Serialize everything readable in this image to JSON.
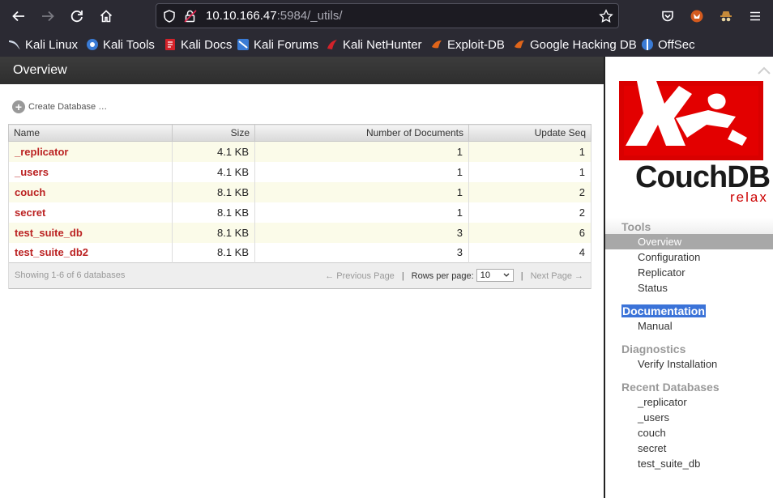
{
  "browser": {
    "url_host": "10.10.166.47",
    "url_rest": ":5984/_utils/",
    "bookmarks": [
      {
        "label": "Kali Linux",
        "color": "#5a9de0"
      },
      {
        "label": "Kali Tools",
        "color": "#3a7bd5"
      },
      {
        "label": "Kali Docs",
        "color": "#d3222a"
      },
      {
        "label": "Kali Forums",
        "color": "#3a7bd5"
      },
      {
        "label": "Kali NetHunter",
        "color": "#d3222a"
      },
      {
        "label": "Exploit-DB",
        "color": "#e0651a"
      },
      {
        "label": "Google Hacking DB",
        "color": "#e0651a"
      },
      {
        "label": "OffSec",
        "color": "#3a7bd5"
      }
    ]
  },
  "page": {
    "title": "Overview",
    "create_db": "Create Database …"
  },
  "table": {
    "headers": [
      "Name",
      "Size",
      "Number of Documents",
      "Update Seq"
    ],
    "rows": [
      {
        "name": "_replicator",
        "size": "4.1 KB",
        "docs": "1",
        "seq": "1"
      },
      {
        "name": "_users",
        "size": "4.1 KB",
        "docs": "1",
        "seq": "1"
      },
      {
        "name": "couch",
        "size": "8.1 KB",
        "docs": "1",
        "seq": "2"
      },
      {
        "name": "secret",
        "size": "8.1 KB",
        "docs": "1",
        "seq": "2"
      },
      {
        "name": "test_suite_db",
        "size": "8.1 KB",
        "docs": "3",
        "seq": "6"
      },
      {
        "name": "test_suite_db2",
        "size": "8.1 KB",
        "docs": "3",
        "seq": "4"
      }
    ],
    "footer": {
      "showing": "Showing 1-6 of 6 databases",
      "prev": "← Previous Page",
      "rows_label": "Rows per page:",
      "rows_value": "10",
      "next": "Next Page →"
    }
  },
  "sidebar": {
    "logo_word": "CouchDB",
    "logo_relax": "relax",
    "tools_heading": "Tools",
    "tools": [
      "Overview",
      "Configuration",
      "Replicator",
      "Status"
    ],
    "docs_heading": "Documentation",
    "docs": [
      "Manual"
    ],
    "diag_heading": "Diagnostics",
    "diag": [
      "Verify Installation"
    ],
    "recent_heading": "Recent Databases",
    "recent": [
      "_replicator",
      "_users",
      "couch",
      "secret",
      "test_suite_db"
    ]
  }
}
